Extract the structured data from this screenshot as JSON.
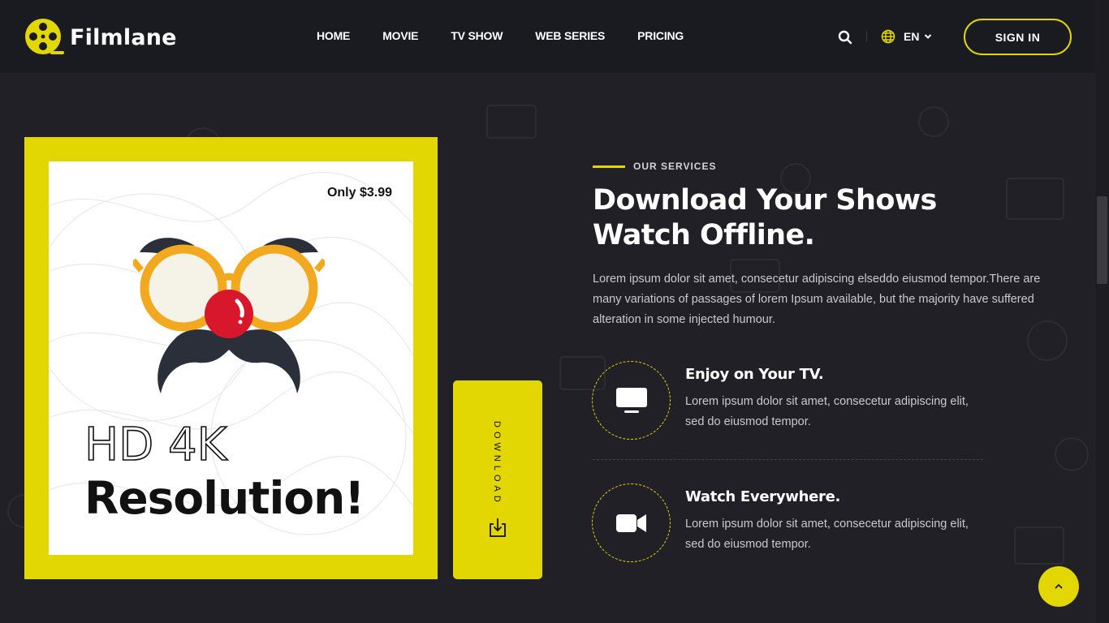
{
  "brand": {
    "name": "Filmlane",
    "accent": "#e2d703",
    "bg": "#212026",
    "header_bg": "#1a1b20"
  },
  "nav": {
    "items": [
      {
        "label": "HOME"
      },
      {
        "label": "MOVIE"
      },
      {
        "label": "TV SHOW"
      },
      {
        "label": "WEB SERIES"
      },
      {
        "label": "PRICING"
      }
    ]
  },
  "header": {
    "search_icon": "search-icon",
    "language": {
      "label": "EN",
      "icon": "globe-icon"
    },
    "signin_label": "SIGN IN"
  },
  "promo": {
    "price": "Only $3.99",
    "line1": "HD 4K",
    "line2": "Resolution!",
    "download_label": "DOWNLOAD"
  },
  "services": {
    "eyebrow": "OUR SERVICES",
    "headline_line1": "Download Your Shows",
    "headline_line2": "Watch Offline.",
    "intro": "Lorem ipsum dolor sit amet, consecetur adipiscing elseddo eiusmod tempor.There are many variations of passages of lorem Ipsum available, but the majority have suffered alteration in some injected humour.",
    "features": [
      {
        "icon": "tv-icon",
        "title": "Enjoy on Your TV.",
        "desc": "Lorem ipsum dolor sit amet, consecetur adipiscing elit, sed do eiusmod tempor."
      },
      {
        "icon": "video-camera-icon",
        "title": "Watch Everywhere.",
        "desc": "Lorem ipsum dolor sit amet, consecetur adipiscing elit, sed do eiusmod tempor."
      }
    ]
  },
  "scroll_top_icon": "chevron-up-icon"
}
